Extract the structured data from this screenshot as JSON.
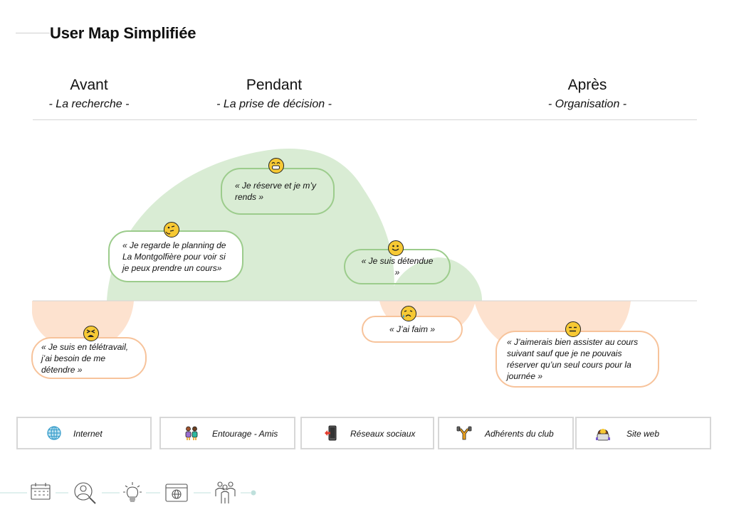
{
  "title": "User Map Simplifiée",
  "phases": [
    {
      "name": "Avant",
      "subtitle": "- La recherche -"
    },
    {
      "name": "Pendant",
      "subtitle": "- La prise de décision -"
    },
    {
      "name": "Après",
      "subtitle": "- Organisation -"
    }
  ],
  "colors": {
    "positive_fill": "#d9ecd4",
    "positive_border": "#9ccc8c",
    "negative_fill": "#fde2cf",
    "negative_border": "#f7c39b",
    "emoji_yellow": "#f7c934"
  },
  "moments": [
    {
      "quote": "« Je regarde le planning de La Montgolfière pour voir si je peux prendre un cours»",
      "emotion": "thinking-face",
      "sentiment": "positive"
    },
    {
      "quote": "« Je réserve et je m’y rends »",
      "emotion": "grinning-face",
      "sentiment": "positive"
    },
    {
      "quote": "« Je suis détendue »",
      "emotion": "slightly-smiling-face",
      "sentiment": "positive"
    },
    {
      "quote": "« Je suis en télétravail, j’ai besoin de me détendre  »",
      "emotion": "tired-face",
      "sentiment": "negative"
    },
    {
      "quote": "« J’ai faim »",
      "emotion": "sad-tear-face",
      "sentiment": "negative"
    },
    {
      "quote": "« J’aimerais bien assister au cours suivant sauf que je ne pouvais réserver qu’un seul cours pour la journée »",
      "emotion": "expressionless-face",
      "sentiment": "negative"
    }
  ],
  "channels": [
    {
      "label": "Internet",
      "icon": "globe-icon"
    },
    {
      "label": "Entourage - Amis",
      "icon": "two-women-icon"
    },
    {
      "label": "Réseaux sociaux",
      "icon": "mobile-phone-arrow-icon"
    },
    {
      "label": "Adhérents du club",
      "icon": "weightlifter-icon"
    },
    {
      "label": "Site web",
      "icon": "person-laptop-icon"
    }
  ],
  "footer_steps": [
    {
      "icon": "calendar-icon"
    },
    {
      "icon": "user-search-icon"
    },
    {
      "icon": "lightbulb-icon"
    },
    {
      "icon": "web-browser-icon"
    },
    {
      "icon": "group-icon"
    }
  ]
}
